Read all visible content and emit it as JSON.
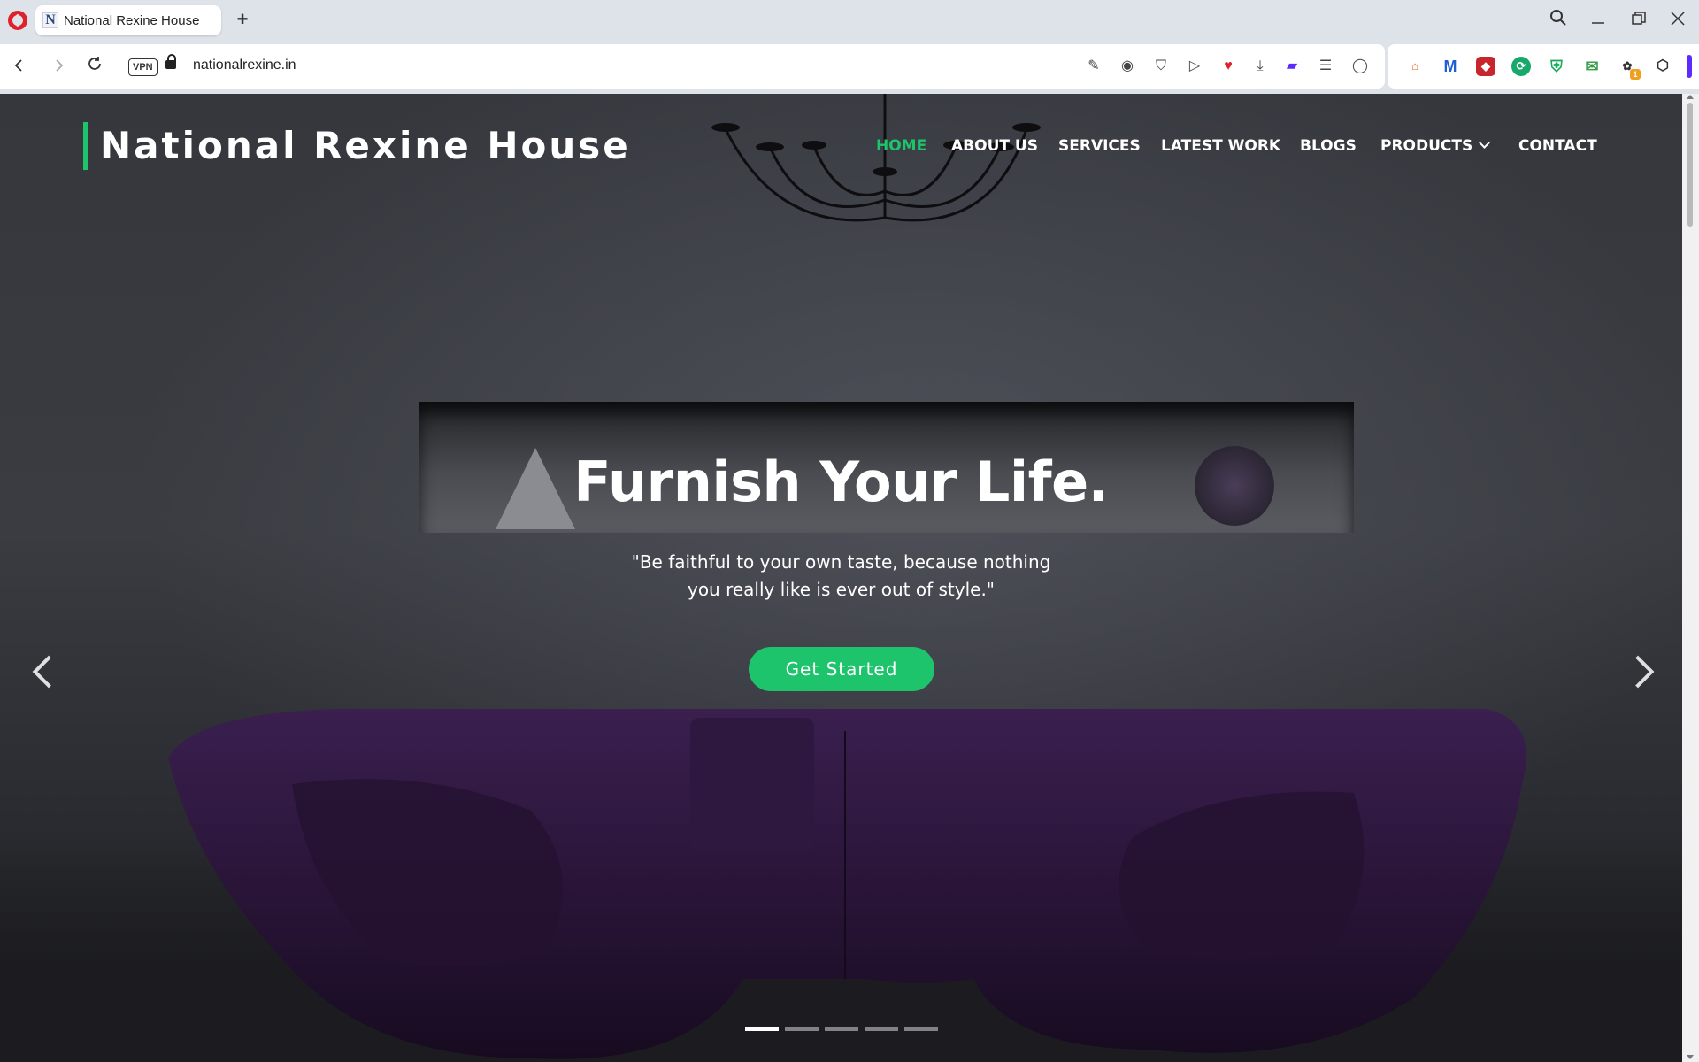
{
  "browser": {
    "tab_title": "National Rexine House",
    "tab_favicon": "N",
    "new_tab_glyph": "+",
    "url": "nationalrexine.in",
    "vpn_label": "VPN",
    "extension_badge_count": "1"
  },
  "site": {
    "brand": "National Rexine House",
    "accent_color": "#1ec46b",
    "nav": [
      {
        "label": "HOME",
        "active": true
      },
      {
        "label": "ABOUT US"
      },
      {
        "label": "SERVICES"
      },
      {
        "label": "LATEST WORK"
      },
      {
        "label": "BLOGS"
      },
      {
        "label": "PRODUCTS",
        "has_dropdown": true
      },
      {
        "label": "CONTACT"
      }
    ]
  },
  "hero": {
    "title": "Furnish Your Life.",
    "quote_line1": "\"Be faithful to your own taste, because nothing",
    "quote_line2": "you really like is ever out of style.\"",
    "cta_label": "Get Started",
    "slide_count": 5,
    "active_slide": 1
  },
  "icons": {
    "back": "chevron-left-icon",
    "forward": "chevron-right-icon",
    "reload": "reload-icon",
    "search": "search-icon"
  }
}
